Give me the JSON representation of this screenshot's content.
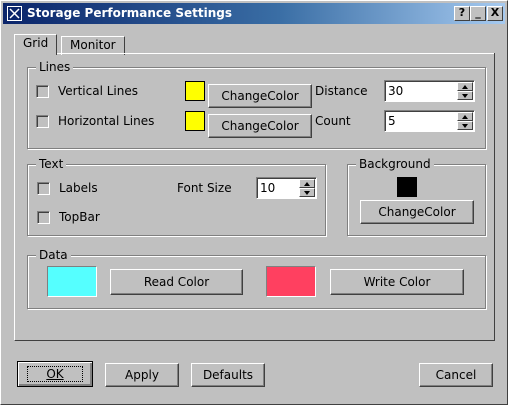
{
  "window": {
    "title": "Storage Performance Settings",
    "help": "?",
    "minimize": "_",
    "close": "X"
  },
  "tabs": [
    {
      "label": "Grid"
    },
    {
      "label": "Monitor"
    }
  ],
  "lines": {
    "title": "Lines",
    "vertical_label": "Vertical Lines",
    "horizontal_label": "Horizontal Lines",
    "vertical_checked": false,
    "horizontal_checked": false,
    "vertical_color": "#ffff00",
    "horizontal_color": "#ffff00",
    "change_color": "ChangeColor",
    "distance_label": "Distance",
    "distance_value": "30",
    "count_label": "Count",
    "count_value": "5"
  },
  "text": {
    "title": "Text",
    "labels_label": "Labels",
    "topbar_label": "TopBar",
    "labels_checked": false,
    "topbar_checked": false,
    "font_size_label": "Font Size",
    "font_size_value": "10"
  },
  "background": {
    "title": "Background",
    "color": "#000000",
    "change_color": "ChangeColor"
  },
  "data_group": {
    "title": "Data",
    "read_color": "#55ffff",
    "write_color": "#ff4060",
    "read_label": "Read Color",
    "write_label": "Write Color"
  },
  "buttons": {
    "ok": "OK",
    "apply": "Apply",
    "defaults": "Defaults",
    "cancel": "Cancel"
  }
}
